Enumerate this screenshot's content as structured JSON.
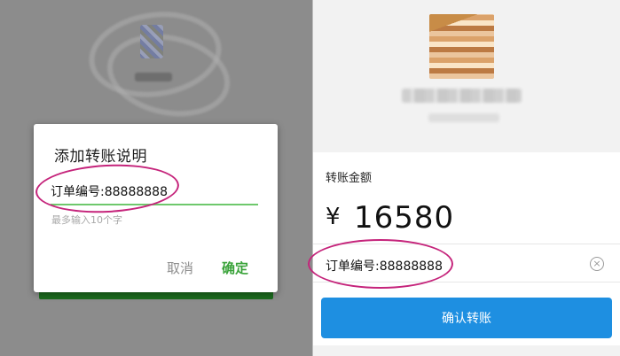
{
  "left": {
    "dialog": {
      "title": "添加转账说明",
      "input_value": "订单编号:88888888",
      "hint": "最多输入10个字",
      "cancel_label": "取消",
      "ok_label": "确定"
    },
    "accent_color": "#3aa33a",
    "underline_color": "#6ec86c"
  },
  "right": {
    "amount_label": "转账金额",
    "currency": "¥",
    "amount": "16580",
    "note_value": "订单编号:88888888",
    "clear_icon": "close-circle-icon",
    "confirm_label": "确认转账",
    "button_color": "#1e8fe1"
  },
  "annotation_color": "#c5247b"
}
